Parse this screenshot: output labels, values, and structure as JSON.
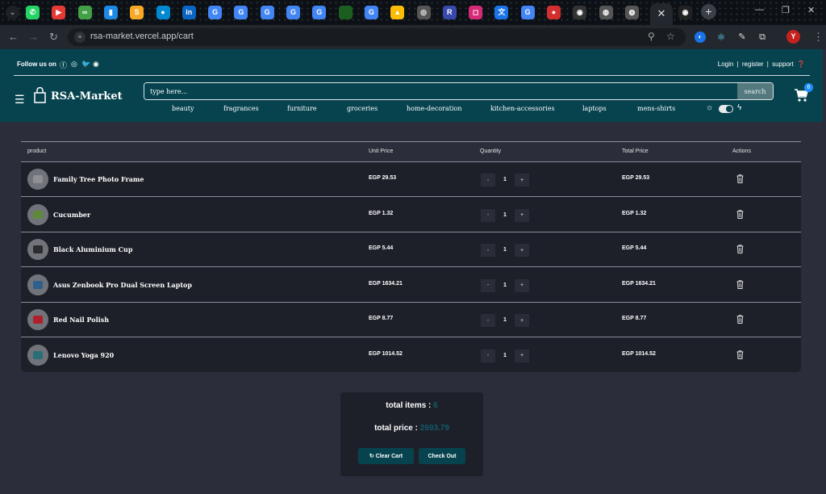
{
  "browser": {
    "url": "rsa-market.vercel.app/cart",
    "profile_initial": "Y",
    "tab_favicons": [
      {
        "icon": "whatsapp-icon",
        "color": "#25d366",
        "glyph": "✆"
      },
      {
        "icon": "youtube-icon",
        "color": "#e53935",
        "glyph": "▶"
      },
      {
        "icon": "app-icon",
        "color": "#43a047",
        "glyph": "∞"
      },
      {
        "icon": "bookmark-icon",
        "color": "#1e88e5",
        "glyph": "▮"
      },
      {
        "icon": "slides-icon",
        "color": "#f9a825",
        "glyph": "S"
      },
      {
        "icon": "circle-app-icon",
        "color": "#0288d1",
        "glyph": "●"
      },
      {
        "icon": "linkedin-icon",
        "color": "#0a66c2",
        "glyph": "in"
      },
      {
        "icon": "google-icon",
        "color": "#4285f4",
        "glyph": "G"
      },
      {
        "icon": "google-icon",
        "color": "#4285f4",
        "glyph": "G"
      },
      {
        "icon": "google-icon",
        "color": "#4285f4",
        "glyph": "G"
      },
      {
        "icon": "google-icon",
        "color": "#4285f4",
        "glyph": "G"
      },
      {
        "icon": "google-icon",
        "color": "#4285f4",
        "glyph": "G"
      },
      {
        "icon": "blank-tab-icon",
        "color": "#1b5e20",
        "glyph": ""
      },
      {
        "icon": "google-icon",
        "color": "#4285f4",
        "glyph": "G"
      },
      {
        "icon": "drive-icon",
        "color": "#fbbc04",
        "glyph": "▲"
      },
      {
        "icon": "openai-icon",
        "color": "#555",
        "glyph": "◎"
      },
      {
        "icon": "r-app-icon",
        "color": "#3949ab",
        "glyph": "R"
      },
      {
        "icon": "instagram-icon",
        "color": "#d62976",
        "glyph": "◻"
      },
      {
        "icon": "translate-icon",
        "color": "#1a73e8",
        "glyph": "文"
      },
      {
        "icon": "google-icon",
        "color": "#4285f4",
        "glyph": "G"
      },
      {
        "icon": "red-app-icon",
        "color": "#d32f2f",
        "glyph": "●"
      },
      {
        "icon": "github-icon",
        "color": "#333",
        "glyph": "◉"
      },
      {
        "icon": "globe-icon",
        "color": "#555",
        "glyph": "◍"
      },
      {
        "icon": "globe-icon",
        "color": "#555",
        "glyph": "◍"
      }
    ],
    "active_tab_icon": "close-icon",
    "extra_tab_icon": "github-icon"
  },
  "header": {
    "follow_label": "Follow us on",
    "login": "Login",
    "register": "register",
    "support": "support",
    "sep": "|",
    "logo": "RSA-Market",
    "search_placeholder": "type here...",
    "search_button": "search",
    "cart_count": "6",
    "categories": [
      "beauty",
      "fragrances",
      "furniture",
      "groceries",
      "home-decoration",
      "kitchen-accessories",
      "laptops",
      "mens-shirts"
    ]
  },
  "table": {
    "headers": {
      "product": "product",
      "unit_price": "Unit Price",
      "quantity": "Quantity",
      "total_price": "Total Price",
      "actions": "Actions"
    },
    "minus": "-",
    "plus": "+",
    "rows": [
      {
        "name": "Family Tree Photo Frame",
        "unit_price": "EGP 29.53",
        "qty": "1",
        "total": "EGP 29.53",
        "thumb_color": "#8d8f95"
      },
      {
        "name": "Cucumber",
        "unit_price": "EGP 1.32",
        "qty": "1",
        "total": "EGP 1.32",
        "thumb_color": "#5e8a3a"
      },
      {
        "name": "Black Aluminium Cup",
        "unit_price": "EGP 5.44",
        "qty": "1",
        "total": "EGP 5.44",
        "thumb_color": "#2c2c30"
      },
      {
        "name": "Asus Zenbook Pro Dual Screen Laptop",
        "unit_price": "EGP 1634.21",
        "qty": "1",
        "total": "EGP 1634.21",
        "thumb_color": "#2f5f8a"
      },
      {
        "name": "Red Nail Polish",
        "unit_price": "EGP 8.77",
        "qty": "1",
        "total": "EGP 8.77",
        "thumb_color": "#b0202a"
      },
      {
        "name": "Lenovo Yoga 920",
        "unit_price": "EGP 1014.52",
        "qty": "1",
        "total": "EGP 1014.52",
        "thumb_color": "#2a6e78"
      }
    ]
  },
  "summary": {
    "items_label": "total items :",
    "items_value": "6",
    "price_label": "total price :",
    "price_value": "2693.79",
    "clear_cart": "Clear Cart",
    "checkout": "Check Out"
  }
}
